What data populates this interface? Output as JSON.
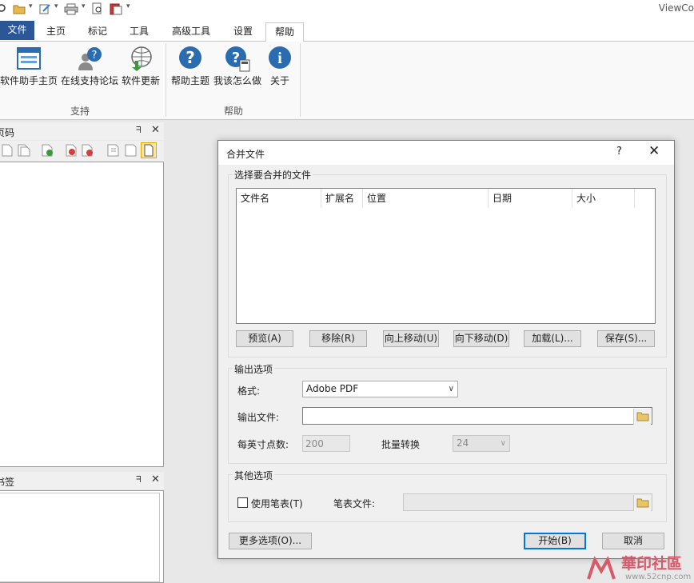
{
  "app": {
    "title": "ViewCo"
  },
  "ribbon": {
    "tabs": {
      "file": "文件",
      "home": "主页",
      "mark": "标记",
      "tools": "工具",
      "advanced": "高级工具",
      "settings": "设置",
      "help": "帮助"
    },
    "support_group": {
      "label": "支持",
      "items": [
        "软件助手主页",
        "在线支持论坛",
        "软件更新"
      ]
    },
    "help_group": {
      "label": "帮助",
      "items": [
        "帮助主题",
        "我该怎么做",
        "关于"
      ]
    }
  },
  "panels": {
    "top_title": "页码",
    "bottom_title": "书签"
  },
  "dialog": {
    "title": "合并文件",
    "help": "?",
    "close": "✕",
    "files_group": {
      "label": "选择要合并的文件",
      "columns": [
        "文件名",
        "扩展名",
        "位置",
        "日期",
        "大小"
      ],
      "buttons": [
        "预览(A)",
        "移除(R)",
        "向上移动(U)",
        "向下移动(D)",
        "加载(L)...",
        "保存(S)..."
      ]
    },
    "output_group": {
      "label": "输出选项",
      "format_label": "格式:",
      "format_value": "Adobe PDF",
      "output_file_label": "输出文件:",
      "output_file_value": "",
      "dpi_label": "每英寸点数:",
      "dpi_value": "200",
      "batch_label": "批量转换",
      "batch_value": "24"
    },
    "other_group": {
      "label": "其他选项",
      "use_pen_label": "使用笔表(T)",
      "use_pen_checked": false,
      "pen_file_label": "笔表文件:",
      "pen_file_value": ""
    },
    "more_options": "更多选项(O)...",
    "start": "开始(B)",
    "cancel": "取消"
  },
  "watermark": {
    "brand": "華印社區",
    "url": "www.52cnp.com"
  }
}
